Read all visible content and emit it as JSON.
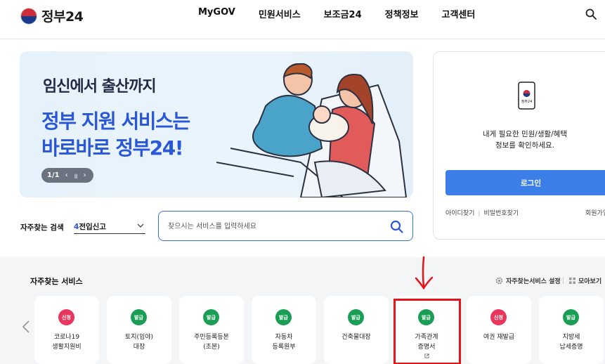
{
  "header": {
    "logo_text": "정부24",
    "nav": [
      "MyGOV",
      "민원서비스",
      "보조금24",
      "정책정보",
      "고객센터"
    ],
    "search_icon": "search-icon"
  },
  "banner": {
    "subtitle": "임신에서 출산까지",
    "title_line1": "정부 지원 서비스는",
    "title_line2": "바로바로 정부24!",
    "pagination": "1/1",
    "prev_icon": "chevron-left-icon",
    "pause_icon": "pause-icon",
    "next_icon": "chevron-right-icon"
  },
  "login": {
    "app_icon_text": "정부24",
    "message_line1": "내게 필요한 민원/생활/혜택",
    "message_line2": "정보를 확인하세요.",
    "login_button": "로그인",
    "find_id": "아이디찾기",
    "find_password": "비밀번호찾기",
    "signup": "회원가입"
  },
  "frequent_search": {
    "label": "자주찾는 검색",
    "selected_number": "4",
    "selected_text": "전입신고",
    "placeholder": "찾으시는 서비스를 입력하세요"
  },
  "services": {
    "title": "자주찾는 서비스",
    "settings": "자주찾는서비스 설정",
    "view_all": "모아보기",
    "items": [
      {
        "badge": "신청",
        "type": "apply",
        "line1": "코로나19",
        "line2": "생활지원비"
      },
      {
        "badge": "발급",
        "type": "issue",
        "line1": "토지(임야)",
        "line2": "대장"
      },
      {
        "badge": "발급",
        "type": "issue",
        "line1": "주민등록등본",
        "line2": "(초본)"
      },
      {
        "badge": "발급",
        "type": "issue",
        "line1": "자동차",
        "line2": "등록원부"
      },
      {
        "badge": "발급",
        "type": "issue",
        "line1": "건축물대장",
        "line2": ""
      },
      {
        "badge": "발급",
        "type": "issue",
        "line1": "가족관계",
        "line2": "증명서"
      },
      {
        "badge": "신청",
        "type": "apply",
        "line1": "여권 재발급",
        "line2": ""
      },
      {
        "badge": "발급",
        "type": "issue",
        "line1": "지방세",
        "line2": "납세증명"
      }
    ]
  },
  "colors": {
    "brand_blue": "#2a56d8",
    "login_button": "#3b7ee8",
    "apply_badge": "#e8365d",
    "issue_badge": "#1a9e56",
    "annotation_red": "#e4141b"
  }
}
